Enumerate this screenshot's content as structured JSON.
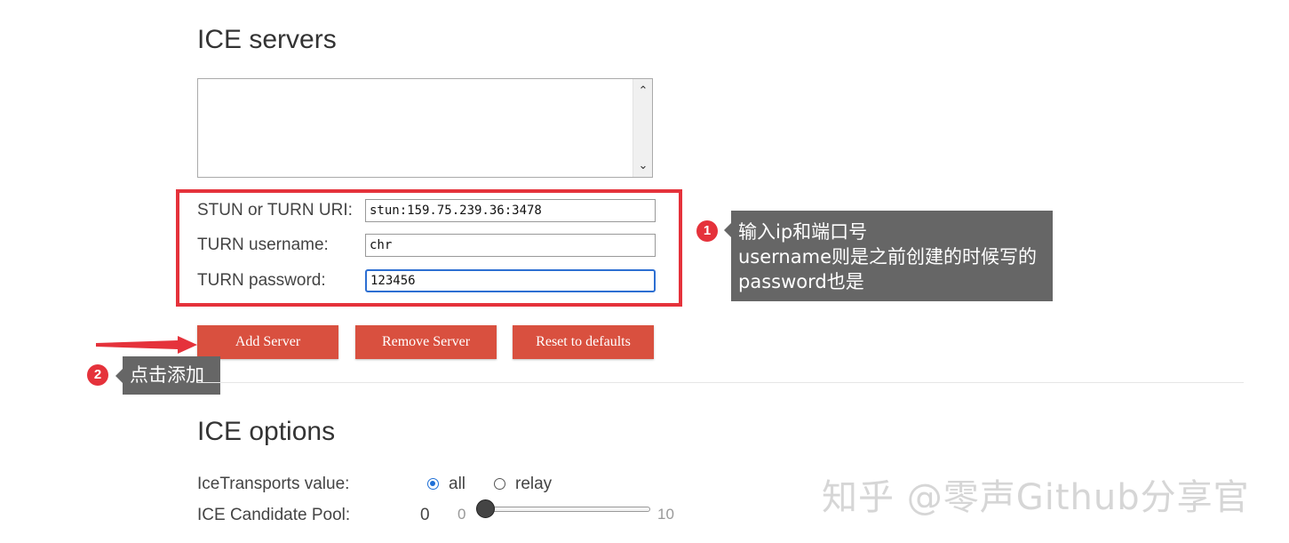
{
  "ice_servers": {
    "heading": "ICE servers",
    "form": {
      "uri_label": "STUN or TURN URI:",
      "uri_value": "stun:159.75.239.36:3478",
      "username_label": "TURN username:",
      "username_value": "chr",
      "password_label": "TURN password:",
      "password_value": "123456"
    },
    "buttons": {
      "add": "Add Server",
      "remove": "Remove Server",
      "reset": "Reset to defaults"
    }
  },
  "annotations": {
    "callout1": {
      "badge": "1",
      "line1": "输入ip和端口号",
      "line2": "username则是之前创建的时候写的",
      "line3": "password也是"
    },
    "callout2": {
      "badge": "2",
      "text": "点击添加"
    },
    "colors": {
      "highlight": "#e5323b",
      "callout_bg": "#666666",
      "button": "#d9503f"
    }
  },
  "ice_options": {
    "heading": "ICE options",
    "transports_label": "IceTransports value:",
    "transport_all": "all",
    "transport_relay": "relay",
    "selected_transport": "all",
    "pool_label": "ICE Candidate Pool:",
    "pool_value": "0",
    "pool_min": "0",
    "pool_max": "10"
  },
  "watermark": "知乎 @零声Github分享官"
}
